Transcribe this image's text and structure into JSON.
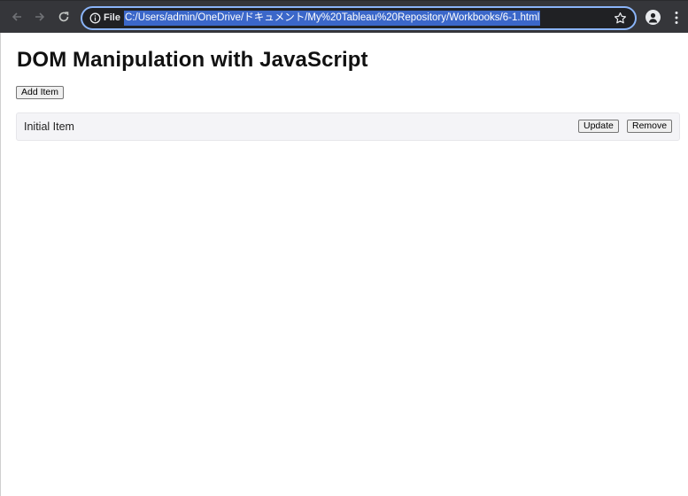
{
  "browser": {
    "scheme_label": "File",
    "url": "C:/Users/admin/OneDrive/ドキュメント/My%20Tableau%20Repository/Workbooks/6-1.html"
  },
  "page": {
    "title": "DOM Manipulation with JavaScript",
    "add_button": "Add Item",
    "items": [
      {
        "label": "Initial Item",
        "update_button": "Update",
        "remove_button": "Remove"
      }
    ]
  }
}
